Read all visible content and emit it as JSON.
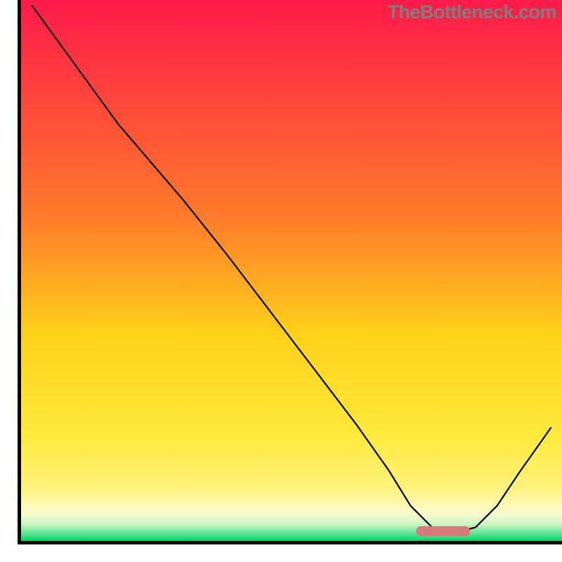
{
  "watermark": "TheBottleneck.com",
  "chart_data": {
    "type": "line",
    "title": "",
    "xlabel": "",
    "ylabel": "",
    "xlim": [
      0,
      100
    ],
    "ylim": [
      0,
      100
    ],
    "gradient_colors": {
      "top": "#ff1a4a",
      "upper_mid": "#ff7a2a",
      "mid": "#ffd21a",
      "lower_mid": "#fff27a",
      "bottom_band": "#fbfbd0",
      "green": "#00d66a"
    },
    "curve": {
      "x": [
        2,
        10,
        18,
        24,
        30,
        38,
        46,
        54,
        62,
        68,
        72,
        76,
        80,
        84,
        88,
        92,
        98
      ],
      "y": [
        99,
        88,
        77,
        70,
        63,
        53,
        42.5,
        32,
        21.5,
        13,
        6.5,
        2.5,
        1.5,
        2.5,
        6.5,
        12.5,
        21
      ]
    },
    "marker_bar": {
      "x_start": 73,
      "x_end": 83,
      "y": 1.8,
      "color": "#d97a7a"
    },
    "frame": {
      "left_margin": 30,
      "bottom_margin": 30,
      "right_margin": 0,
      "top_margin": 0,
      "axis_width": 5
    }
  }
}
